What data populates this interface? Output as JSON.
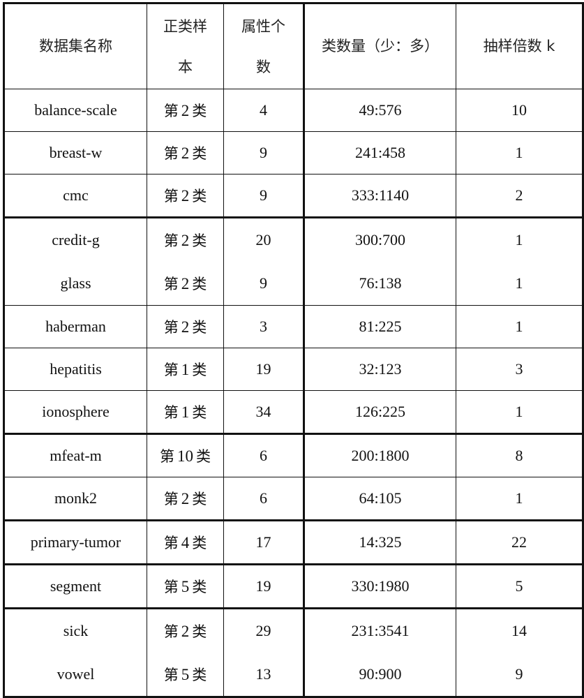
{
  "table": {
    "headers": {
      "name": "数据集名称",
      "positive_class_line1": "正类样",
      "positive_class_line2": "本",
      "attributes_line1": "属性个",
      "attributes_line2": "数",
      "class_count": "类数量（少：多）",
      "sampling_factor": "抽样倍数 k"
    },
    "rows": [
      {
        "name": "balance-scale",
        "class_prefix": "第",
        "class_num": "2",
        "class_suffix": "类",
        "attributes": "4",
        "ratio": "49:576",
        "k": "10"
      },
      {
        "name": "breast-w",
        "class_prefix": "第",
        "class_num": "2",
        "class_suffix": "类",
        "attributes": "9",
        "ratio": "241:458",
        "k": "1"
      },
      {
        "name": "cmc",
        "class_prefix": "第",
        "class_num": "2",
        "class_suffix": "类",
        "attributes": "9",
        "ratio": "333:1140",
        "k": "2"
      },
      {
        "name": "credit-g",
        "class_prefix": "第",
        "class_num": "2",
        "class_suffix": "类",
        "attributes": "20",
        "ratio": "300:700",
        "k": "1"
      },
      {
        "name": "glass",
        "class_prefix": "第",
        "class_num": "2",
        "class_suffix": "类",
        "attributes": "9",
        "ratio": "76:138",
        "k": "1"
      },
      {
        "name": "haberman",
        "class_prefix": "第",
        "class_num": "2",
        "class_suffix": "类",
        "attributes": "3",
        "ratio": "81:225",
        "k": "1"
      },
      {
        "name": "hepatitis",
        "class_prefix": "第",
        "class_num": "1",
        "class_suffix": "类",
        "attributes": "19",
        "ratio": "32:123",
        "k": "3"
      },
      {
        "name": "ionosphere",
        "class_prefix": "第",
        "class_num": "1",
        "class_suffix": "类",
        "attributes": "34",
        "ratio": "126:225",
        "k": "1"
      },
      {
        "name": "mfeat-m",
        "class_prefix": "第",
        "class_num": "10",
        "class_suffix": "类",
        "attributes": "6",
        "ratio": "200:1800",
        "k": "8"
      },
      {
        "name": "monk2",
        "class_prefix": "第",
        "class_num": "2",
        "class_suffix": "类",
        "attributes": "6",
        "ratio": "64:105",
        "k": "1"
      },
      {
        "name": "primary-tumor",
        "class_prefix": "第",
        "class_num": "4",
        "class_suffix": "类",
        "attributes": "17",
        "ratio": "14:325",
        "k": "22"
      },
      {
        "name": "segment",
        "class_prefix": "第",
        "class_num": "5",
        "class_suffix": "类",
        "attributes": "19",
        "ratio": "330:1980",
        "k": "5"
      },
      {
        "name": "sick",
        "class_prefix": "第",
        "class_num": "2",
        "class_suffix": "类",
        "attributes": "29",
        "ratio": "231:3541",
        "k": "14"
      },
      {
        "name": "vowel",
        "class_prefix": "第",
        "class_num": "5",
        "class_suffix": "类",
        "attributes": "13",
        "ratio": "90:900",
        "k": "9"
      }
    ]
  }
}
